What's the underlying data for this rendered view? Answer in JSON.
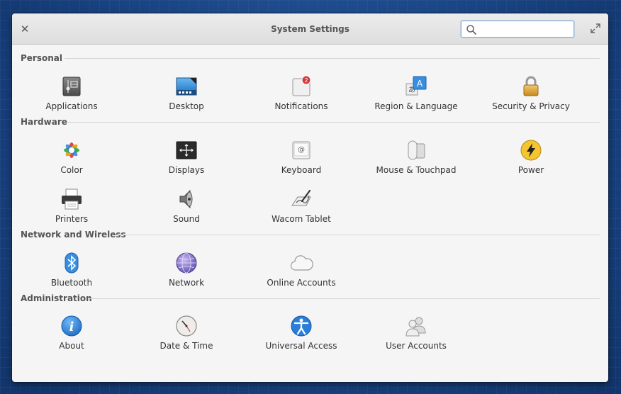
{
  "window": {
    "title": "System Settings",
    "close_glyph": "✕",
    "search_placeholder": ""
  },
  "sections": [
    {
      "heading": "Personal"
    },
    {
      "heading": "Hardware"
    },
    {
      "heading": "Network and Wireless"
    },
    {
      "heading": "Administration"
    }
  ],
  "items": {
    "applications": {
      "label": "Applications",
      "icon": "applications-icon"
    },
    "desktop": {
      "label": "Desktop",
      "icon": "desktop-icon"
    },
    "notifications": {
      "label": "Notifications",
      "icon": "notifications-icon",
      "badge": "2"
    },
    "region": {
      "label": "Region & Language",
      "icon": "region-language-icon",
      "glyph": "A"
    },
    "security": {
      "label": "Security & Privacy",
      "icon": "lock-icon"
    },
    "color": {
      "label": "Color",
      "icon": "color-icon"
    },
    "displays": {
      "label": "Displays",
      "icon": "displays-icon"
    },
    "keyboard": {
      "label": "Keyboard",
      "icon": "keyboard-icon",
      "glyph": "@"
    },
    "mouse": {
      "label": "Mouse & Touchpad",
      "icon": "mouse-icon"
    },
    "power": {
      "label": "Power",
      "icon": "power-icon"
    },
    "printers": {
      "label": "Printers",
      "icon": "printer-icon"
    },
    "sound": {
      "label": "Sound",
      "icon": "speaker-icon"
    },
    "wacom": {
      "label": "Wacom Tablet",
      "icon": "tablet-icon"
    },
    "bluetooth": {
      "label": "Bluetooth",
      "icon": "bluetooth-icon"
    },
    "network": {
      "label": "Network",
      "icon": "network-icon"
    },
    "online": {
      "label": "Online Accounts",
      "icon": "cloud-icon"
    },
    "about": {
      "label": "About",
      "icon": "info-icon",
      "glyph": "i"
    },
    "datetime": {
      "label": "Date & Time",
      "icon": "clock-icon"
    },
    "universal": {
      "label": "Universal Access",
      "icon": "accessibility-icon"
    },
    "users": {
      "label": "User Accounts",
      "icon": "users-icon"
    }
  },
  "colors": {
    "window_bg": "#f5f5f5",
    "badge": "#d83a3a",
    "power": "#f4c530",
    "blue": "#3a8ee0"
  }
}
